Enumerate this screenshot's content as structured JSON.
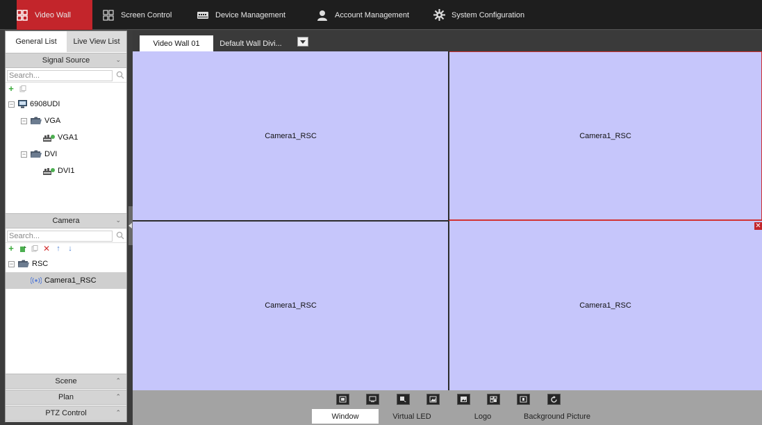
{
  "menu": [
    {
      "label": "Video Wall",
      "icon": "video-wall-icon",
      "active": true
    },
    {
      "label": "Screen Control",
      "icon": "screen-control-icon",
      "active": false
    },
    {
      "label": "Device Management",
      "icon": "device-management-icon",
      "active": false
    },
    {
      "label": "Account Management",
      "icon": "account-icon",
      "active": false
    },
    {
      "label": "System Configuration",
      "icon": "gear-icon",
      "active": false
    }
  ],
  "left_tabs": [
    "General List",
    "Live View List"
  ],
  "signal_source": {
    "title": "Signal Source",
    "search_placeholder": "Search...",
    "tree": [
      {
        "label": "6908UDI",
        "icon": "monitor-icon",
        "level": 0,
        "expander": "−"
      },
      {
        "label": "VGA",
        "icon": "folder-icon",
        "level": 1,
        "expander": "−"
      },
      {
        "label": "VGA1",
        "icon": "input-port-icon",
        "level": 2,
        "expander": ""
      },
      {
        "label": "DVI",
        "icon": "folder-icon",
        "level": 1,
        "expander": "−"
      },
      {
        "label": "DVI1",
        "icon": "input-port-icon",
        "level": 2,
        "expander": ""
      }
    ]
  },
  "camera": {
    "title": "Camera",
    "search_placeholder": "Search...",
    "tree": [
      {
        "label": "RSC",
        "icon": "folder-icon",
        "level": 0,
        "expander": "−"
      },
      {
        "label": "Camera1_RSC",
        "icon": "camera-signal-icon",
        "level": 1,
        "expander": "",
        "selected": true
      }
    ]
  },
  "collapsed_sections": [
    "Scene",
    "Plan",
    "PTZ Control"
  ],
  "wall_tabs": {
    "active": "Video Wall 01",
    "inactive": "Default Wall Divi..."
  },
  "wall_cells": [
    "Camera1_RSC",
    "Camera1_RSC",
    "Camera1_RSC",
    "Camera1_RSC"
  ],
  "bottom_tabs": [
    "Window",
    "Virtual LED",
    "Logo",
    "Background Picture"
  ],
  "colors": {
    "accent": "#c3252b",
    "wall_bg": "#c6c6fb",
    "topbar": "#1e1e1e"
  }
}
